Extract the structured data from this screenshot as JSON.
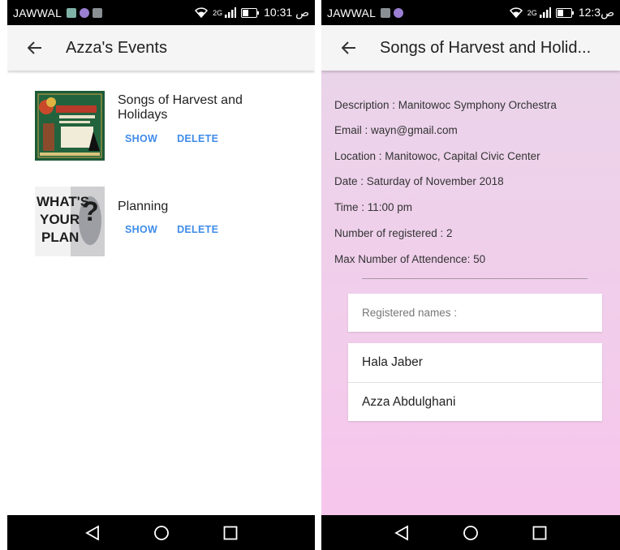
{
  "left": {
    "status": {
      "carrier": "JAWWAL",
      "network": "2G",
      "time": "10:31 ص"
    },
    "appbar": {
      "title": "Azza's Events"
    },
    "events": [
      {
        "title": "Songs of Harvest and Holidays",
        "show_label": "SHOW",
        "delete_label": "DELETE",
        "thumb": "songs-poster"
      },
      {
        "title": "Planning",
        "show_label": "SHOW",
        "delete_label": "DELETE",
        "thumb": "whats-your-plan"
      }
    ]
  },
  "right": {
    "status": {
      "carrier": "JAWWAL",
      "network": "2G",
      "time": "12:3ص"
    },
    "appbar": {
      "title": "Songs of Harvest and Holid..."
    },
    "details": {
      "description": "Description : Manitowoc Symphony Orchestra",
      "email": "Email : wayn@gmail.com",
      "location": "Location : Manitowoc, Capital Civic Center",
      "date": "Date : Saturday of November 2018",
      "time": "Time : 11:00 pm",
      "registered": "Number of registered : 2",
      "max": "Max Number of Attendence: 50"
    },
    "registered_header": "Registered names :",
    "names": [
      "Hala Jaber",
      "Azza Abdulghani"
    ]
  },
  "colors": {
    "accent": "#3f8ce8",
    "appbar": "#f5f5f5",
    "bg_gradient_end": "#f7c4ec"
  }
}
